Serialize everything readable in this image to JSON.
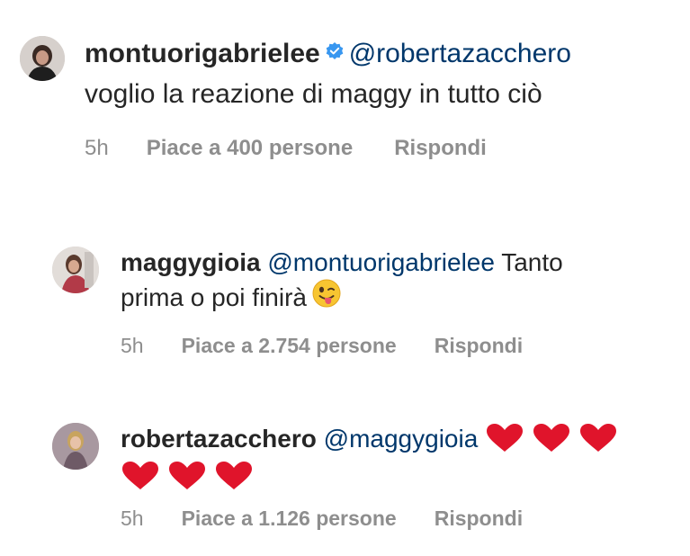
{
  "comments": [
    {
      "username": "montuorigabrielee",
      "verified": true,
      "mention": "@robertazacchero",
      "text": "voglio la reazione di maggy in tutto ciò",
      "time": "5h",
      "likes": "Piace a 400 persone",
      "reply": "Rispondi"
    },
    {
      "username": "maggygioia",
      "mention": "@montuorigabrielee",
      "text_line1": "Tanto",
      "text_line2": "prima o poi finirà",
      "emoji": "winking-face-with-tongue-emoji",
      "time": "5h",
      "likes": "Piace a 2.754 persone",
      "reply": "Rispondi"
    },
    {
      "username": "robertazacchero",
      "mention": "@maggygioia",
      "hearts_line1": "❤️❤️❤️",
      "hearts_line2": "❤️❤️❤️",
      "time": "5h",
      "likes": "Piace a 1.126 persone",
      "reply": "Rispondi"
    }
  ],
  "colors": {
    "text": "#262626",
    "mention": "#00376b",
    "meta": "#8e8e8e",
    "verified": "#3897f0",
    "heart": "#e0142b"
  }
}
